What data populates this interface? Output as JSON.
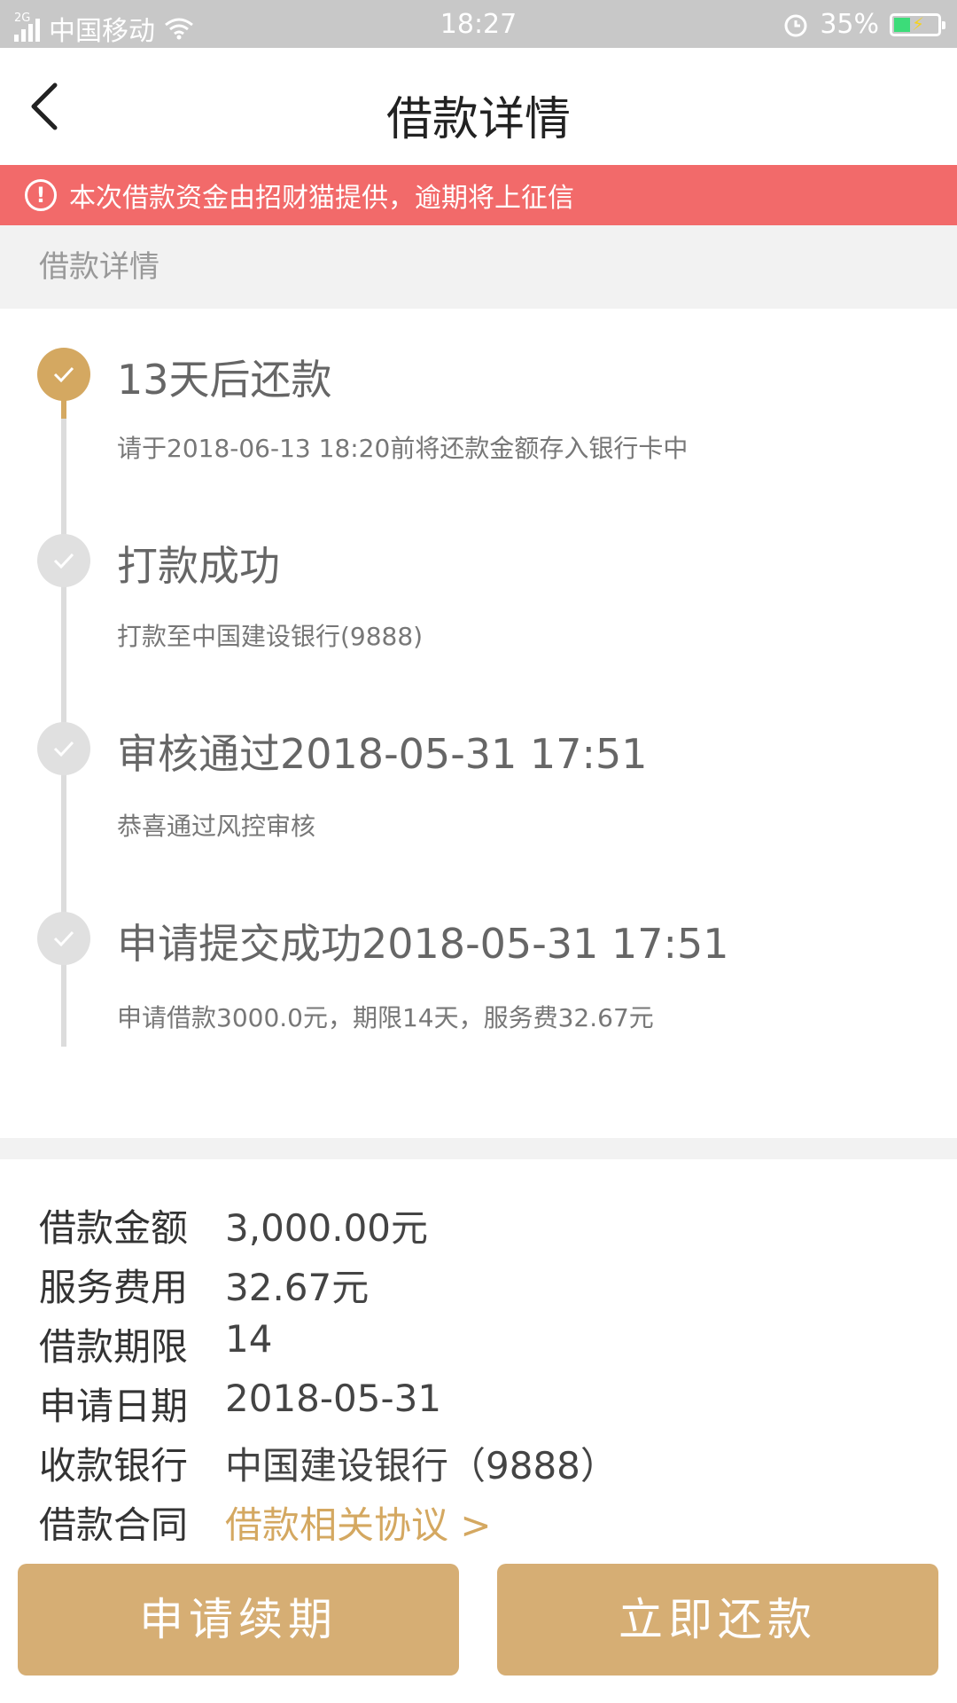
{
  "status_bar": {
    "network": "2G",
    "carrier": "中国移动",
    "time": "18:27",
    "battery": "35%",
    "battery_level": 0.35
  },
  "header": {
    "title": "借款详情"
  },
  "notice": {
    "text": "本次借款资金由招财猫提供，逾期将上征信"
  },
  "section": {
    "title": "借款详情"
  },
  "timeline": [
    {
      "title": "13天后还款",
      "desc": "请于2018-06-13 18:20前将还款金额存入银行卡中",
      "active": true
    },
    {
      "title": "打款成功",
      "desc": "打款至中国建设银行(9888)",
      "active": false
    },
    {
      "title": "审核通过2018-05-31 17:51",
      "desc": "恭喜通过风控审核",
      "active": false
    },
    {
      "title": "申请提交成功2018-05-31 17:51",
      "desc": "申请借款3000.0元，期限14天，服务费32.67元",
      "active": false
    }
  ],
  "details": [
    {
      "label": "借款金额",
      "value": "3,000.00元"
    },
    {
      "label": "服务费用",
      "value": "32.67元"
    },
    {
      "label": "借款期限",
      "value": "14"
    },
    {
      "label": "申请日期",
      "value": "2018-05-31"
    },
    {
      "label": "收款银行",
      "value": "中国建设银行（9888）"
    },
    {
      "label": "借款合同",
      "value": "借款相关协议 >"
    }
  ],
  "buttons": {
    "renew": "申请续期",
    "repay": "立即还款"
  },
  "colors": {
    "accent": "#d4a861",
    "button": "#d6ae74",
    "notice": "#f26a6a",
    "status_bar": "#c8c8c8"
  }
}
